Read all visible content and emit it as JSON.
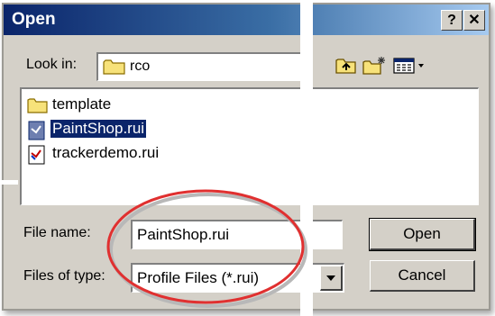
{
  "window": {
    "title": "Open",
    "help_label": "?",
    "close_label": "✕"
  },
  "lookin": {
    "label": "Look in:",
    "value": "rco"
  },
  "toolbar": {
    "icons": [
      "up-folder-icon",
      "new-folder-icon",
      "view-menu-icon"
    ]
  },
  "files": [
    {
      "name": "template",
      "type": "folder",
      "selected": false
    },
    {
      "name": "PaintShop.rui",
      "type": "rui",
      "selected": true
    },
    {
      "name": "trackerdemo.rui",
      "type": "rui",
      "selected": false
    }
  ],
  "filename": {
    "label": "File name:",
    "value": "PaintShop.rui"
  },
  "filetype": {
    "label": "Files of type:",
    "value": "Profile Files (*.rui)"
  },
  "buttons": {
    "open": "Open",
    "cancel": "Cancel"
  },
  "colors": {
    "title_start": "#0a246a",
    "title_end": "#a6caf0",
    "highlight_ellipse": "#e03030",
    "selection": "#0a246a"
  }
}
